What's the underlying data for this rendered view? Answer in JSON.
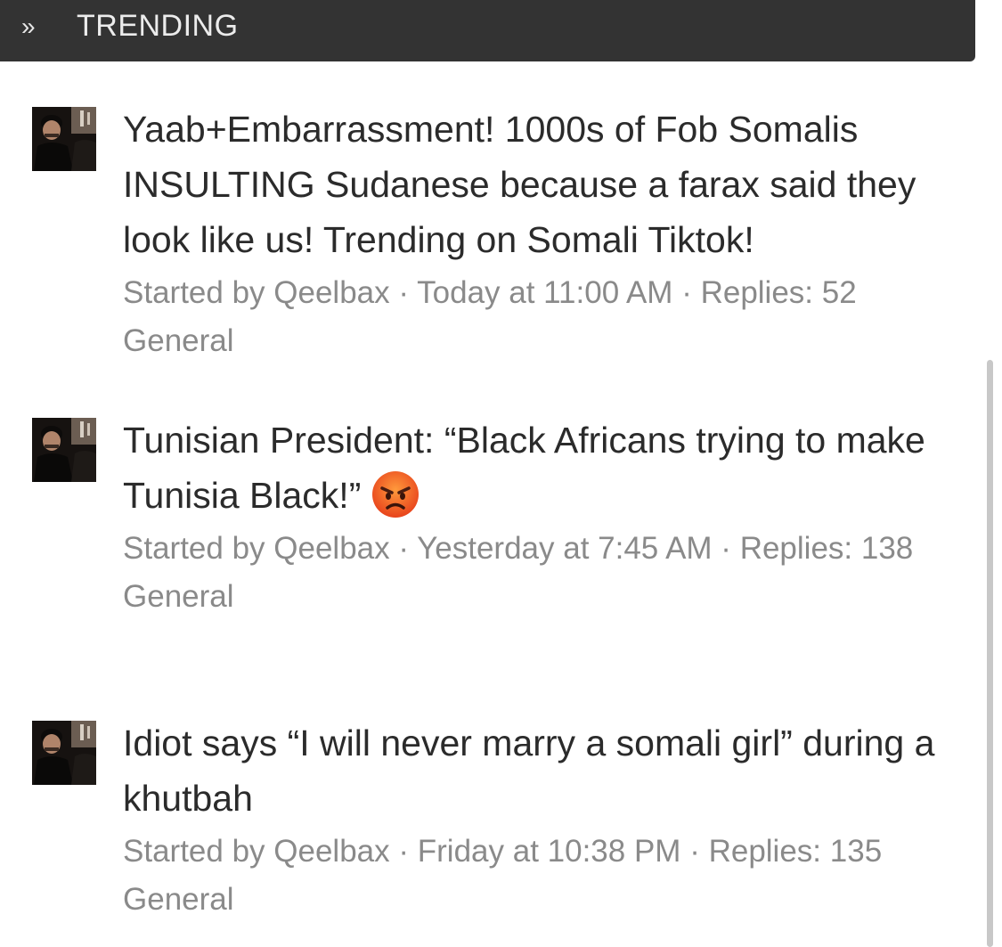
{
  "header": {
    "chevron": "»",
    "title": "TRENDING"
  },
  "threads": [
    {
      "title": "Yaab+Embarrassment! 1000s of Fob Somalis INSULTING Sudanese because a farax said they look like us! Trending on Somali Tiktok!",
      "author_prefix": "Started by",
      "author": "Qeelbax",
      "sep1": " · ",
      "time": "Today at 11:00 AM",
      "sep2": " · ",
      "replies_label": "Replies:",
      "replies": "52",
      "forum": "General",
      "avatar_icon": "user-avatar-icon"
    },
    {
      "title": "Tunisian President: “Black Africans trying to make Tunisia Black!”",
      "emoji": "angry-face-icon",
      "author_prefix": "Started by",
      "author": "Qeelbax",
      "sep1": " · ",
      "time": "Yesterday at 7:45 AM",
      "sep2": " · ",
      "replies_label": "Replies:",
      "replies": "138",
      "forum": "General",
      "avatar_icon": "user-avatar-icon"
    },
    {
      "title": "Idiot says “I will never marry a somali girl” during a khutbah",
      "author_prefix": "Started by",
      "author": "Qeelbax",
      "sep1": " · ",
      "time": "Friday at 10:38 PM",
      "sep2": " · ",
      "replies_label": "Replies:",
      "replies": "135",
      "forum": "General",
      "avatar_icon": "user-avatar-icon"
    }
  ],
  "colors": {
    "header_bg": "#333333",
    "header_text": "#ececec",
    "title_text": "#2b2b2b",
    "meta_text": "#8a8a8a"
  }
}
